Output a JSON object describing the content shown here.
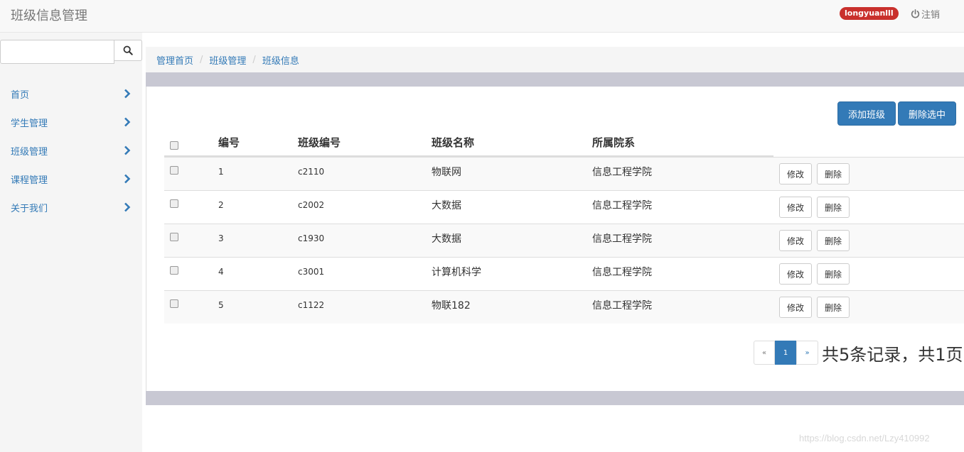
{
  "app": {
    "title": "班级信息管理"
  },
  "header": {
    "user": "longyuanlll",
    "logout_label": "注销"
  },
  "sidebar": {
    "search_placeholder": "",
    "items": [
      {
        "label": "首页"
      },
      {
        "label": "学生管理"
      },
      {
        "label": "班级管理"
      },
      {
        "label": "课程管理"
      },
      {
        "label": "关于我们"
      }
    ]
  },
  "breadcrumb": [
    "管理首页",
    "班级管理",
    "班级信息"
  ],
  "toolbar": {
    "add_label": "添加班级",
    "delete_selected_label": "删除选中"
  },
  "table": {
    "headers": [
      "编号",
      "班级编号",
      "班级名称",
      "所属院系"
    ],
    "rows": [
      {
        "id": "1",
        "code": "c2110",
        "name": "物联网",
        "dept": "信息工程学院"
      },
      {
        "id": "2",
        "code": "c2002",
        "name": "大数据",
        "dept": "信息工程学院"
      },
      {
        "id": "3",
        "code": "c1930",
        "name": "大数据",
        "dept": "信息工程学院"
      },
      {
        "id": "4",
        "code": "c3001",
        "name": "计算机科学",
        "dept": "信息工程学院"
      },
      {
        "id": "5",
        "code": "c1122",
        "name": "物联182",
        "dept": "信息工程学院"
      }
    ],
    "edit_label": "修改",
    "delete_label": "删除"
  },
  "pagination": {
    "prev": "«",
    "current": "1",
    "next": "»",
    "info": "共5条记录，共1页"
  },
  "watermark": "https://blog.csdn.net/Lzy410992",
  "colors": {
    "primary": "#337ab7",
    "badge": "#c9302c",
    "band": "#c8c8d3"
  }
}
